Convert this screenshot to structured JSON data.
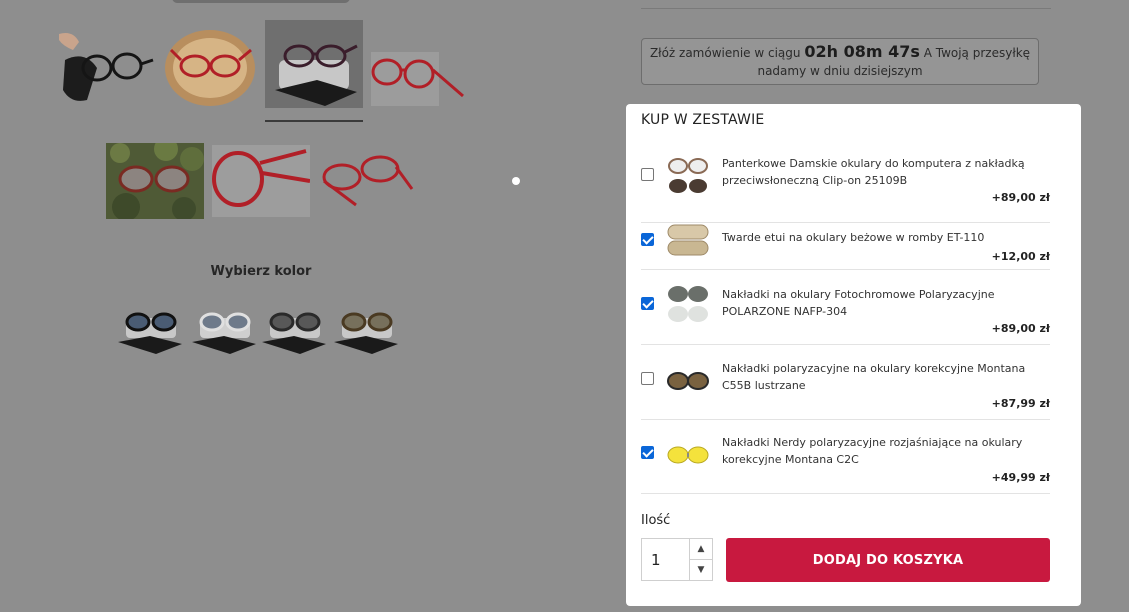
{
  "gallery": {
    "thumbnails": [
      {
        "icon": "glasses-with-cloth-photo"
      },
      {
        "icon": "red-glasses-on-wood-photo"
      },
      {
        "icon": "glasses-on-case-photo",
        "active": true
      },
      {
        "icon": "red-glasses-side-photo"
      },
      {
        "icon": "glasses-on-moss-photo"
      },
      {
        "icon": "red-glasses-closeup-photo"
      },
      {
        "icon": "red-glasses-folded-photo"
      }
    ]
  },
  "color_picker": {
    "title": "Wybierz kolor",
    "swatches": [
      "black-frame",
      "white-frame",
      "dark-frame",
      "tortoise-frame"
    ]
  },
  "countdown": {
    "prefix": "Złóż zamówienie w ciągu",
    "timer": "02h 08m 47s",
    "suffix": "A Twoją przesyłkę",
    "line2": "nadamy w dniu dzisiejszym"
  },
  "bundle": {
    "title": "KUP W ZESTAWIE",
    "items": [
      {
        "name": "Panterkowe Damskie okulary do komputera z nakładką przeciwsłoneczną Clip-on 25109B",
        "price": "+89,00 zł",
        "checked": false,
        "icon": "clip-on-glasses-thumbnail"
      },
      {
        "name": "Twarde etui na okulary beżowe w romby ET-110",
        "price": "+12,00 zł",
        "checked": true,
        "icon": "beige-case-thumbnail"
      },
      {
        "name": "Nakładki na okulary Fotochromowe Polaryzacyjne POLARZONE NAFP-304",
        "price": "+89,00 zł",
        "checked": true,
        "icon": "photochromic-clip-thumbnail"
      },
      {
        "name": "Nakładki polaryzacyjne na okulary korekcyjne Montana C55B lustrzane",
        "price": "+87,99 zł",
        "checked": false,
        "icon": "mirror-clip-thumbnail"
      },
      {
        "name": "Nakładki Nerdy polaryzacyjne rozjaśniające na okulary korekcyjne Montana C2C",
        "price": "+49,99 zł",
        "checked": true,
        "icon": "yellow-clip-thumbnail"
      }
    ]
  },
  "quantity": {
    "label": "Ilość",
    "value": "1"
  },
  "cart": {
    "button_label": "DODAJ DO KOSZYKA",
    "accent": "#c8193f"
  }
}
